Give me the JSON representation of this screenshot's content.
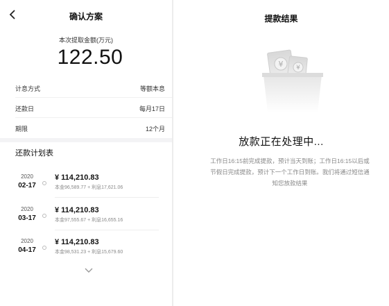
{
  "left": {
    "title": "确认方案",
    "amount_label": "本次提取金额(万元)",
    "amount": "122.50",
    "rows": [
      {
        "key": "计息方式",
        "value": "等额本息"
      },
      {
        "key": "还款日",
        "value": "每月17日"
      },
      {
        "key": "期限",
        "value": "12个月"
      }
    ],
    "schedule_title": "还款计划表",
    "schedule": [
      {
        "year": "2020",
        "md": "02-17",
        "amount": "¥ 114,210.83",
        "detail": "本金96,589.77 + 利息17,621.06"
      },
      {
        "year": "2020",
        "md": "03-17",
        "amount": "¥ 114,210.83",
        "detail": "本金97,555.67 + 利息16,655.16"
      },
      {
        "year": "2020",
        "md": "04-17",
        "amount": "¥ 114,210.83",
        "detail": "本金98,531.23 + 利息15,679.60"
      }
    ]
  },
  "right": {
    "title": "提款结果",
    "status": "放款正在处理中...",
    "info": "工作日16:15前完成提款，预计当天到账；工作日16:15以后或节假日完成提款，预计下一个工作日到账。我们将通过短信通知您放款结果"
  },
  "icons": {
    "back": "chevron-left-icon",
    "expand": "chevron-down-icon",
    "illustration": "money-box-illustration"
  }
}
